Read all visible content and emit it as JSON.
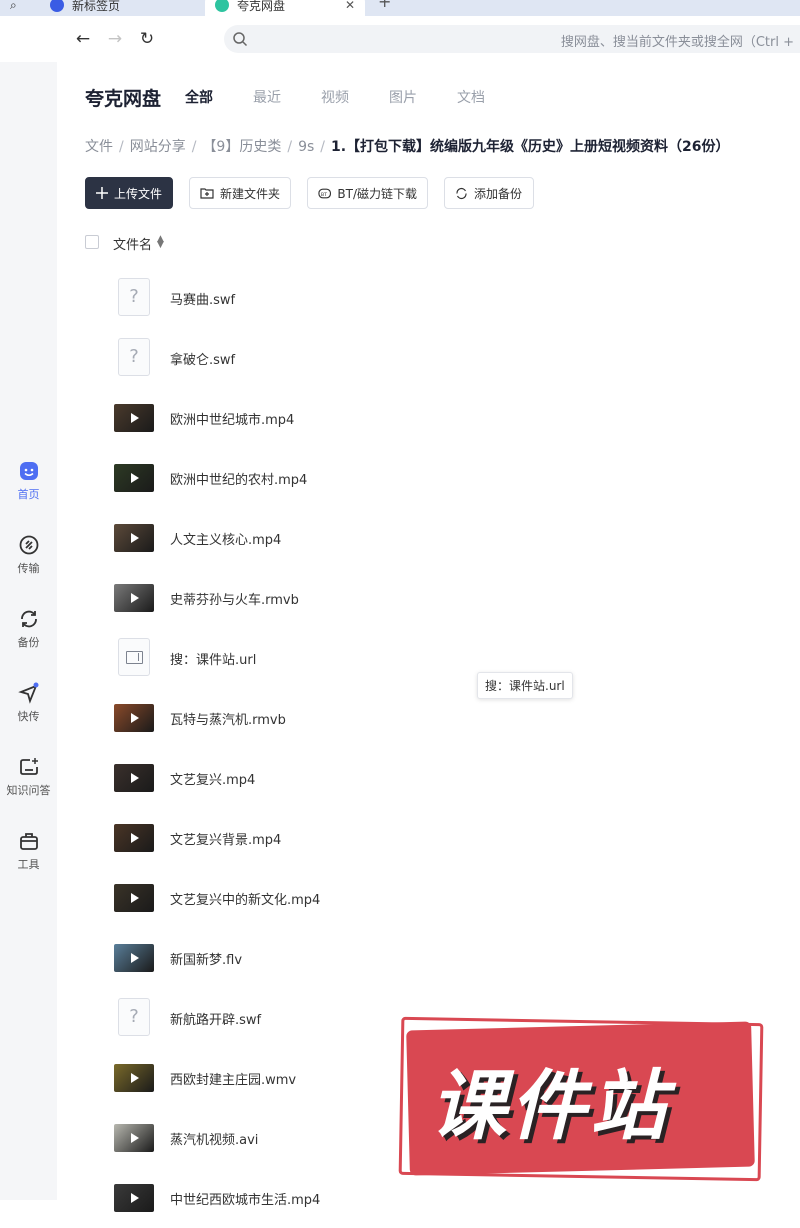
{
  "browser": {
    "tabs": [
      {
        "label": "",
        "icon": "search-tab-icon"
      },
      {
        "label": "新标签页",
        "icon": "browser-logo-icon"
      },
      {
        "label": "夸克网盘",
        "icon": "quark-logo-icon"
      }
    ],
    "omnibox_placeholder": "搜网盘、搜当前文件夹或搜全网（Ctrl +"
  },
  "sidebar": {
    "items": [
      {
        "label": "首页",
        "icon": "home-icon",
        "active": true
      },
      {
        "label": "传输",
        "icon": "transfer-icon"
      },
      {
        "label": "备份",
        "icon": "backup-icon"
      },
      {
        "label": "快传",
        "icon": "quick-send-icon"
      },
      {
        "label": "知识问答",
        "icon": "knowledge-qa-icon"
      },
      {
        "label": "工具",
        "icon": "tools-icon"
      }
    ]
  },
  "header": {
    "brand": "夸克网盘",
    "categories": [
      "全部",
      "最近",
      "视频",
      "图片",
      "文档"
    ],
    "active_category": "全部"
  },
  "breadcrumb": [
    "文件",
    "网站分享",
    "【9】历史类",
    "9s",
    "1.【打包下载】统编版九年级《历史》上册短视频资料（26份）"
  ],
  "toolbar": {
    "upload": "上传文件",
    "new_folder": "新建文件夹",
    "bt_download": "BT/磁力链下载",
    "add_backup": "添加备份"
  },
  "list": {
    "column_name": "文件名",
    "files": [
      {
        "name": "马赛曲.swf",
        "kind": "unknown"
      },
      {
        "name": "拿破仑.swf",
        "kind": "unknown"
      },
      {
        "name": "欧洲中世纪城市.mp4",
        "kind": "video",
        "tint": "#4a3a2c"
      },
      {
        "name": "欧洲中世纪的农村.mp4",
        "kind": "video",
        "tint": "#2d3a24"
      },
      {
        "name": "人文主义核心.mp4",
        "kind": "video",
        "tint": "#5c4a3a"
      },
      {
        "name": "史蒂芬孙与火车.rmvb",
        "kind": "video",
        "tint": "#7a7a7a"
      },
      {
        "name": "搜：课件站.url",
        "kind": "url"
      },
      {
        "name": "瓦特与蒸汽机.rmvb",
        "kind": "video",
        "tint": "#8a4a2a"
      },
      {
        "name": "文艺复兴.mp4",
        "kind": "video",
        "tint": "#3a302c"
      },
      {
        "name": "文艺复兴背景.mp4",
        "kind": "video",
        "tint": "#4a3526"
      },
      {
        "name": "文艺复兴中的新文化.mp4",
        "kind": "video",
        "tint": "#3a3328"
      },
      {
        "name": "新国新梦.flv",
        "kind": "video",
        "tint": "#5a7f9a"
      },
      {
        "name": "新航路开辟.swf",
        "kind": "unknown"
      },
      {
        "name": "西欧封建主庄园.wmv",
        "kind": "video",
        "tint": "#7a6a2a"
      },
      {
        "name": "蒸汽机视频.avi",
        "kind": "video",
        "tint": "#b8b8b0"
      },
      {
        "name": "中世纪西欧城市生活.mp4",
        "kind": "video",
        "tint": "#3a3a3a"
      }
    ]
  },
  "tooltip": "搜：课件站.url",
  "watermark": "课件站",
  "colors": {
    "accent": "#4e6ef2",
    "primary_button": "#2c3344",
    "watermark_red": "#d94852"
  }
}
